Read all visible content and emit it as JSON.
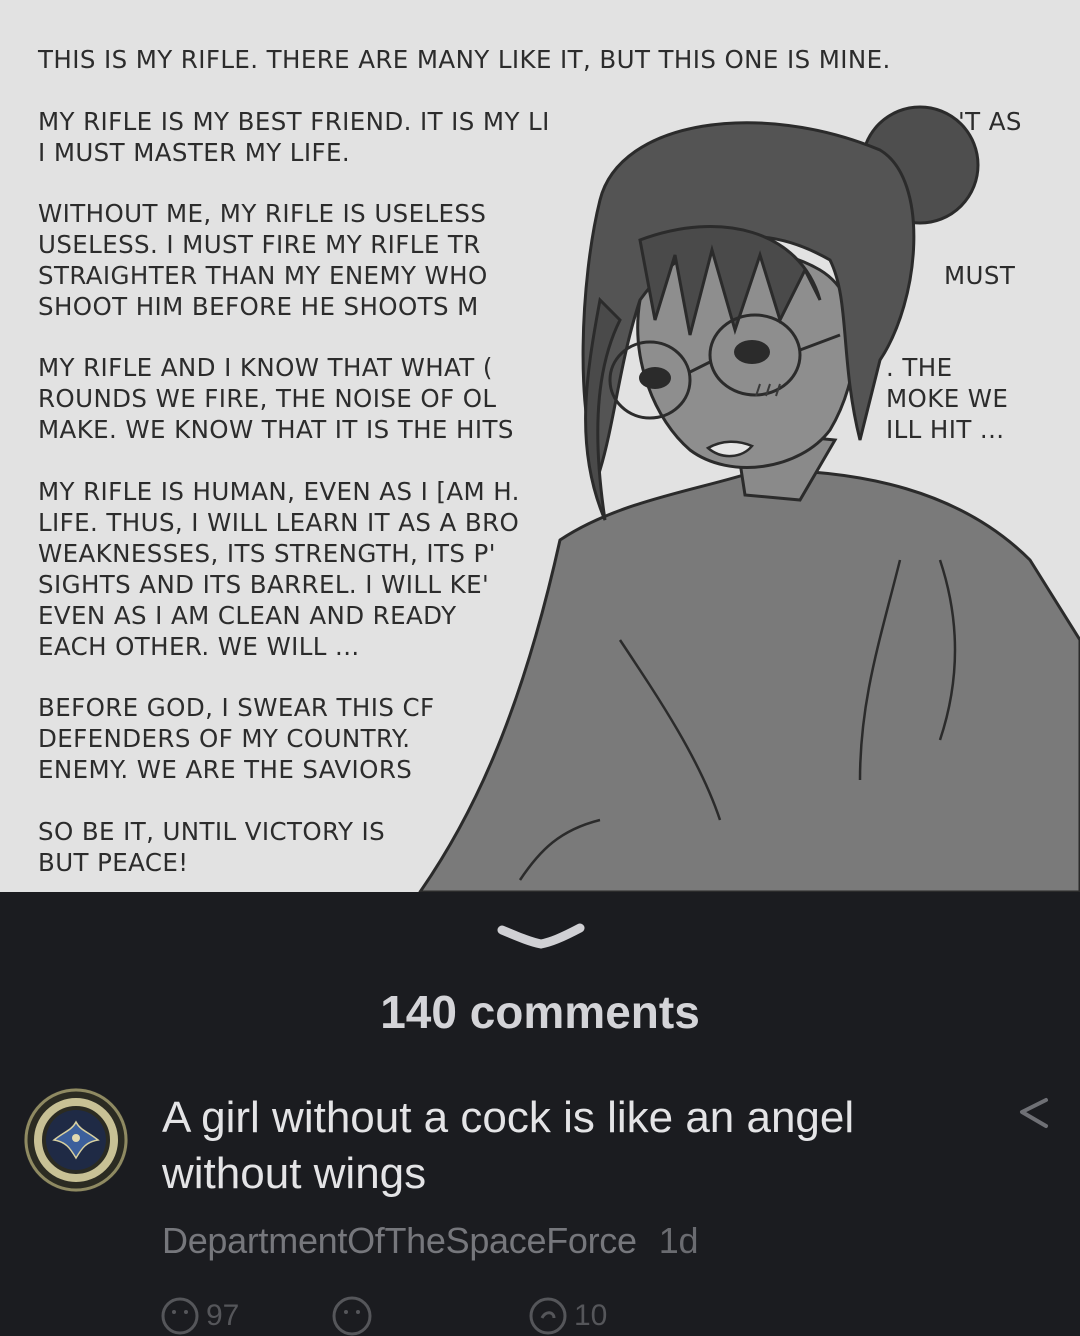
{
  "post": {
    "comic_paragraphs": [
      "THIS IS MY RIFLE. THERE ARE MANY LIKE IT, BUT THIS ONE IS MINE.",
      "MY RIFLE IS MY BEST FRIEND. IT IS MY LI",
      "I MUST MASTER MY LIFE.",
      "'T AS",
      "WITHOUT ME, MY RIFLE IS USELESS\nUSELESS. I MUST FIRE MY RIFLE TR\nSTRAIGHTER THAN MY ENEMY WHO\nSHOOT HIM BEFORE HE SHOOTS M",
      "MUST",
      "MY RIFLE AND I KNOW THAT WHAT (\nROUNDS WE FIRE, THE NOISE OF OL\nMAKE. WE KNOW THAT IT IS THE HITS",
      ". THE\nMOKE WE\nILL HIT ...",
      "MY RIFLE IS HUMAN, EVEN AS I [AM H.\nLIFE. THUS, I WILL LEARN IT AS A BRO\nWEAKNESSES, ITS STRENGTH, ITS P'\nSIGHTS AND ITS BARREL. I WILL KE'\nEVEN AS I AM CLEAN AND READY\nEACH OTHER. WE WILL ...",
      "BEFORE GOD, I SWEAR THIS CF\nDEFENDERS OF MY COUNTRY.\nENEMY. WE ARE THE SAVIORS",
      "SO BE IT, UNTIL VICTORY IS\nBUT PEACE!"
    ]
  },
  "comments": {
    "count_label": "140 comments"
  },
  "comment": {
    "text": "A girl without a cock is like an angel without wings",
    "author": "DepartmentOfTheSpaceForce",
    "age": "1d",
    "upvotes": "97",
    "replies": "10"
  },
  "icons": {
    "collapse": "chevron-down-icon",
    "share": "share-icon",
    "upvote": "smile-icon",
    "downvote": "frown-icon",
    "reply": "reply-icon"
  },
  "colors": {
    "background": "#1b1c20",
    "panel": "#e2e2e2",
    "comment_text": "#e4e4e6",
    "meta_text": "#76777c"
  }
}
